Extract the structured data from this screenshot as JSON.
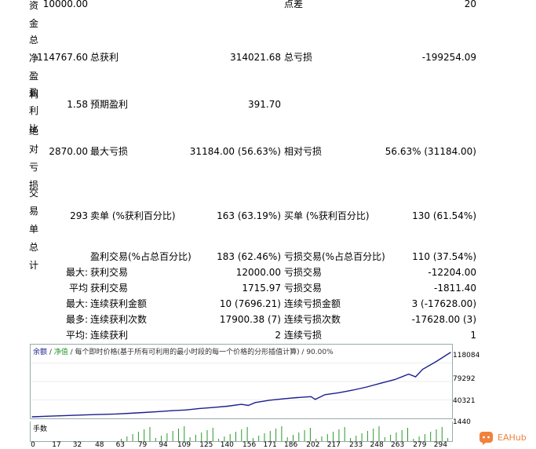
{
  "left_labels": [
    {
      "text": "资金",
      "chars": [
        "资",
        "金"
      ]
    },
    {
      "text": "总净盈利",
      "chars": [
        "总",
        "净",
        "盈",
        "利"
      ]
    },
    {
      "text": "盈利比",
      "chars": [
        "盈",
        "利",
        "比"
      ]
    },
    {
      "text": "绝对亏损",
      "chars": [
        "绝",
        "对",
        "亏",
        "损"
      ]
    },
    {
      "text": "交易单总计",
      "chars": [
        "交",
        "易",
        "单",
        "总",
        "计"
      ]
    }
  ],
  "rows": [
    {
      "v1": "10000.00",
      "l2": "",
      "v2": "",
      "l3": "点差",
      "v3": "20"
    },
    {
      "v1": "114767.60",
      "l2": "总获利",
      "v2": "314021.68",
      "l3": "总亏损",
      "v3": "-199254.09"
    },
    {
      "v1": "1.58",
      "l2": "预期盈利",
      "v2": "391.70",
      "l3": "",
      "v3": ""
    },
    {
      "v1": "2870.00",
      "l2": "最大亏损",
      "v2": "31184.00 (56.63%)",
      "l3": "相对亏损",
      "v3": "56.63% (31184.00)"
    },
    {
      "v1": "293",
      "l2": "卖单 (%获利百分比)",
      "v2": "163 (63.19%)",
      "l3": "买单 (%获利百分比)",
      "v3": "130 (61.54%)"
    }
  ],
  "lower_rows": [
    {
      "prefix": "",
      "l2": "盈利交易(%占总百分比)",
      "v2": "183 (62.46%)",
      "l3": "亏损交易(%占总百分比)",
      "v3": "110 (37.54%)"
    },
    {
      "prefix": "最大:",
      "l2": "获利交易",
      "v2": "12000.00",
      "l3": "亏损交易",
      "v3": "-12204.00"
    },
    {
      "prefix": "平均",
      "l2": "获利交易",
      "v2": "1715.97",
      "l3": "亏损交易",
      "v3": "-1811.40"
    },
    {
      "prefix": "最大:",
      "l2": "连续获利金额",
      "v2": "10 (7696.21)",
      "l3": "连续亏损金额",
      "v3": "3 (-17628.00)"
    },
    {
      "prefix": "最多:",
      "l2": "连续获利次数",
      "v2": "17900.38 (7)",
      "l3": "连续亏损次数",
      "v3": "-17628.00 (3)"
    },
    {
      "prefix": "平均:",
      "l2": "连续获利",
      "v2": "2",
      "l3": "连续亏损",
      "v3": "1"
    }
  ],
  "chart": {
    "legend_balance": "余额",
    "legend_sep1": " / ",
    "legend_equity": "净值",
    "legend_rest": " / 每个即时价格(基于所有可利用的最小时段的每一个价格的分形插值计算) / 90.00%",
    "volume_label": "手数",
    "balance_color": "#1b1f8f",
    "equity_color": "#2a9a2a"
  },
  "chart_data": {
    "type": "line",
    "y_ticks": [
      "118084",
      "79292",
      "40321",
      "1440"
    ],
    "x_ticks": [
      "0",
      "17",
      "32",
      "48",
      "63",
      "79",
      "94",
      "109",
      "125",
      "140",
      "156",
      "171",
      "186",
      "202",
      "217",
      "233",
      "248",
      "263",
      "279",
      "294"
    ],
    "ylim": [
      1440,
      118084
    ],
    "xlim": [
      0,
      300
    ],
    "series": [
      {
        "values_x": [
          0,
          10,
          20,
          30,
          40,
          50,
          60,
          70,
          80,
          90,
          100,
          110,
          120,
          130,
          140,
          150,
          155,
          160,
          170,
          180,
          190,
          200,
          203,
          210,
          220,
          230,
          240,
          250,
          260,
          270,
          275,
          280,
          290,
          300
        ],
        "values_y": [
          1440,
          2500,
          3300,
          4200,
          5100,
          5800,
          6600,
          7800,
          9200,
          10800,
          12500,
          13800,
          16500,
          18400,
          20600,
          24100,
          22000,
          27300,
          31400,
          34000,
          36300,
          38000,
          33000,
          41500,
          45100,
          49800,
          55500,
          62300,
          68900,
          78800,
          74000,
          87500,
          101800,
          118084
        ]
      }
    ]
  },
  "badge": {
    "text": "EAHub",
    "color": "#f0823c"
  }
}
